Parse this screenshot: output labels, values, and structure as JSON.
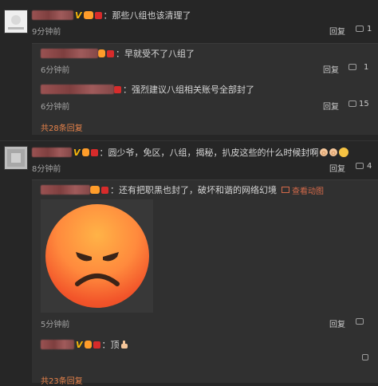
{
  "comments": [
    {
      "text": "：那些八组也该清理了",
      "time": "9分钟前",
      "reply_label": "回复",
      "like_count": "1",
      "replies": [
        {
          "text": "：早就受不了八组了",
          "time": "6分钟前",
          "reply_label": "回复",
          "like_count": "1"
        },
        {
          "text": "：强烈建议八组相关账号全部封了",
          "time": "6分钟前",
          "reply_label": "回复",
          "like_count": "15"
        }
      ],
      "more_replies": "共28条回复"
    },
    {
      "text": "：圆少爷，免区，八组，揭秘，扒皮这些的什么时候封啊",
      "time": "8分钟前",
      "reply_label": "回复",
      "like_count": "4",
      "replies": [
        {
          "text": "：还有把职黑也封了，破坏和谐的网络幻境",
          "view_anim": "查看动图",
          "time": "5分钟前",
          "reply_label": "回复",
          "like_count": ""
        },
        {
          "text": "：顶",
          "time": "",
          "reply_label": "",
          "like_count": ""
        }
      ],
      "more_replies": "共23条回复"
    }
  ],
  "colors": {
    "background": "#262626",
    "reply_background": "#303030",
    "accent": "#e6824a"
  }
}
